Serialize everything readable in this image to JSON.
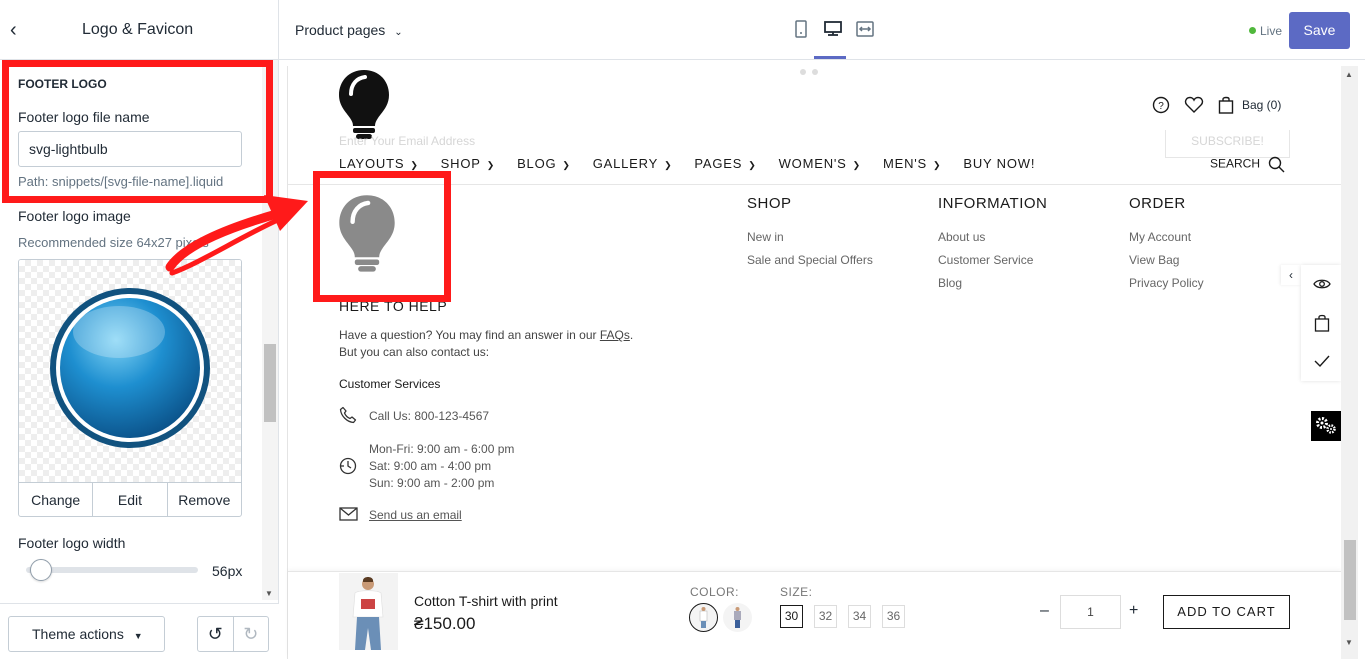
{
  "sidebar": {
    "title": "Logo & Favicon",
    "section_title": "FOOTER LOGO",
    "file_name_label": "Footer logo file name",
    "file_name_value": "svg-lightbulb",
    "path_help": "Path: snippets/[svg-file-name].liquid",
    "image_label": "Footer logo image",
    "image_help": "Recommended size 64x27 pixels",
    "image_buttons": [
      "Change",
      "Edit",
      "Remove"
    ],
    "width_label": "Footer logo width",
    "width_value": "56px",
    "width_fraction": 0.05,
    "theme_actions": "Theme actions"
  },
  "topbar": {
    "page_selector": "Product pages",
    "live": "Live",
    "save": "Save"
  },
  "preview": {
    "newsletter_placeholder": "Enter Your Email Address",
    "subscribe": "SUBSCRIBE!",
    "bag": "Bag (0)",
    "nav": [
      "LAYOUTS",
      "SHOP",
      "BLOG",
      "GALLERY",
      "PAGES",
      "WOMEN'S",
      "MEN'S",
      "BUY NOW!"
    ],
    "nav_dropdown": [
      true,
      true,
      true,
      true,
      true,
      true,
      true,
      false
    ],
    "search": "SEARCH",
    "footer_columns": [
      {
        "title": "SHOP",
        "links": [
          "New in",
          "Sale and Special Offers"
        ]
      },
      {
        "title": "INFORMATION",
        "links": [
          "About us",
          "Customer Service",
          "Blog"
        ]
      },
      {
        "title": "ORDER",
        "links": [
          "My Account",
          "View Bag",
          "Privacy Policy"
        ]
      }
    ],
    "help_title": "HERE TO HELP",
    "help_line1": "Have a question? You may find an answer in our ",
    "faqs": "FAQs",
    "help_line1_end": ".",
    "help_line2": "But you can also contact us:",
    "customer_services": "Customer Services",
    "call": "Call Us: 800-123-4567",
    "hours": [
      "Mon-Fri: 9:00 am - 6:00 pm",
      "Sat: 9:00 am - 4:00 pm",
      "Sun: 9:00 am - 2:00 pm"
    ],
    "email_link": "Send us an email"
  },
  "product_bar": {
    "name": "Cotton T-shirt with print",
    "price": "₴150.00",
    "color_label": "COLOR:",
    "size_label": "SIZE:",
    "sizes": [
      "30",
      "32",
      "34",
      "36"
    ],
    "selected_size": "30",
    "quantity": "1",
    "add_to_cart": "ADD TO CART"
  },
  "colors": {
    "accent": "#5c6ac4",
    "live": "#50b83c",
    "annotation": "#ff1a1a"
  }
}
